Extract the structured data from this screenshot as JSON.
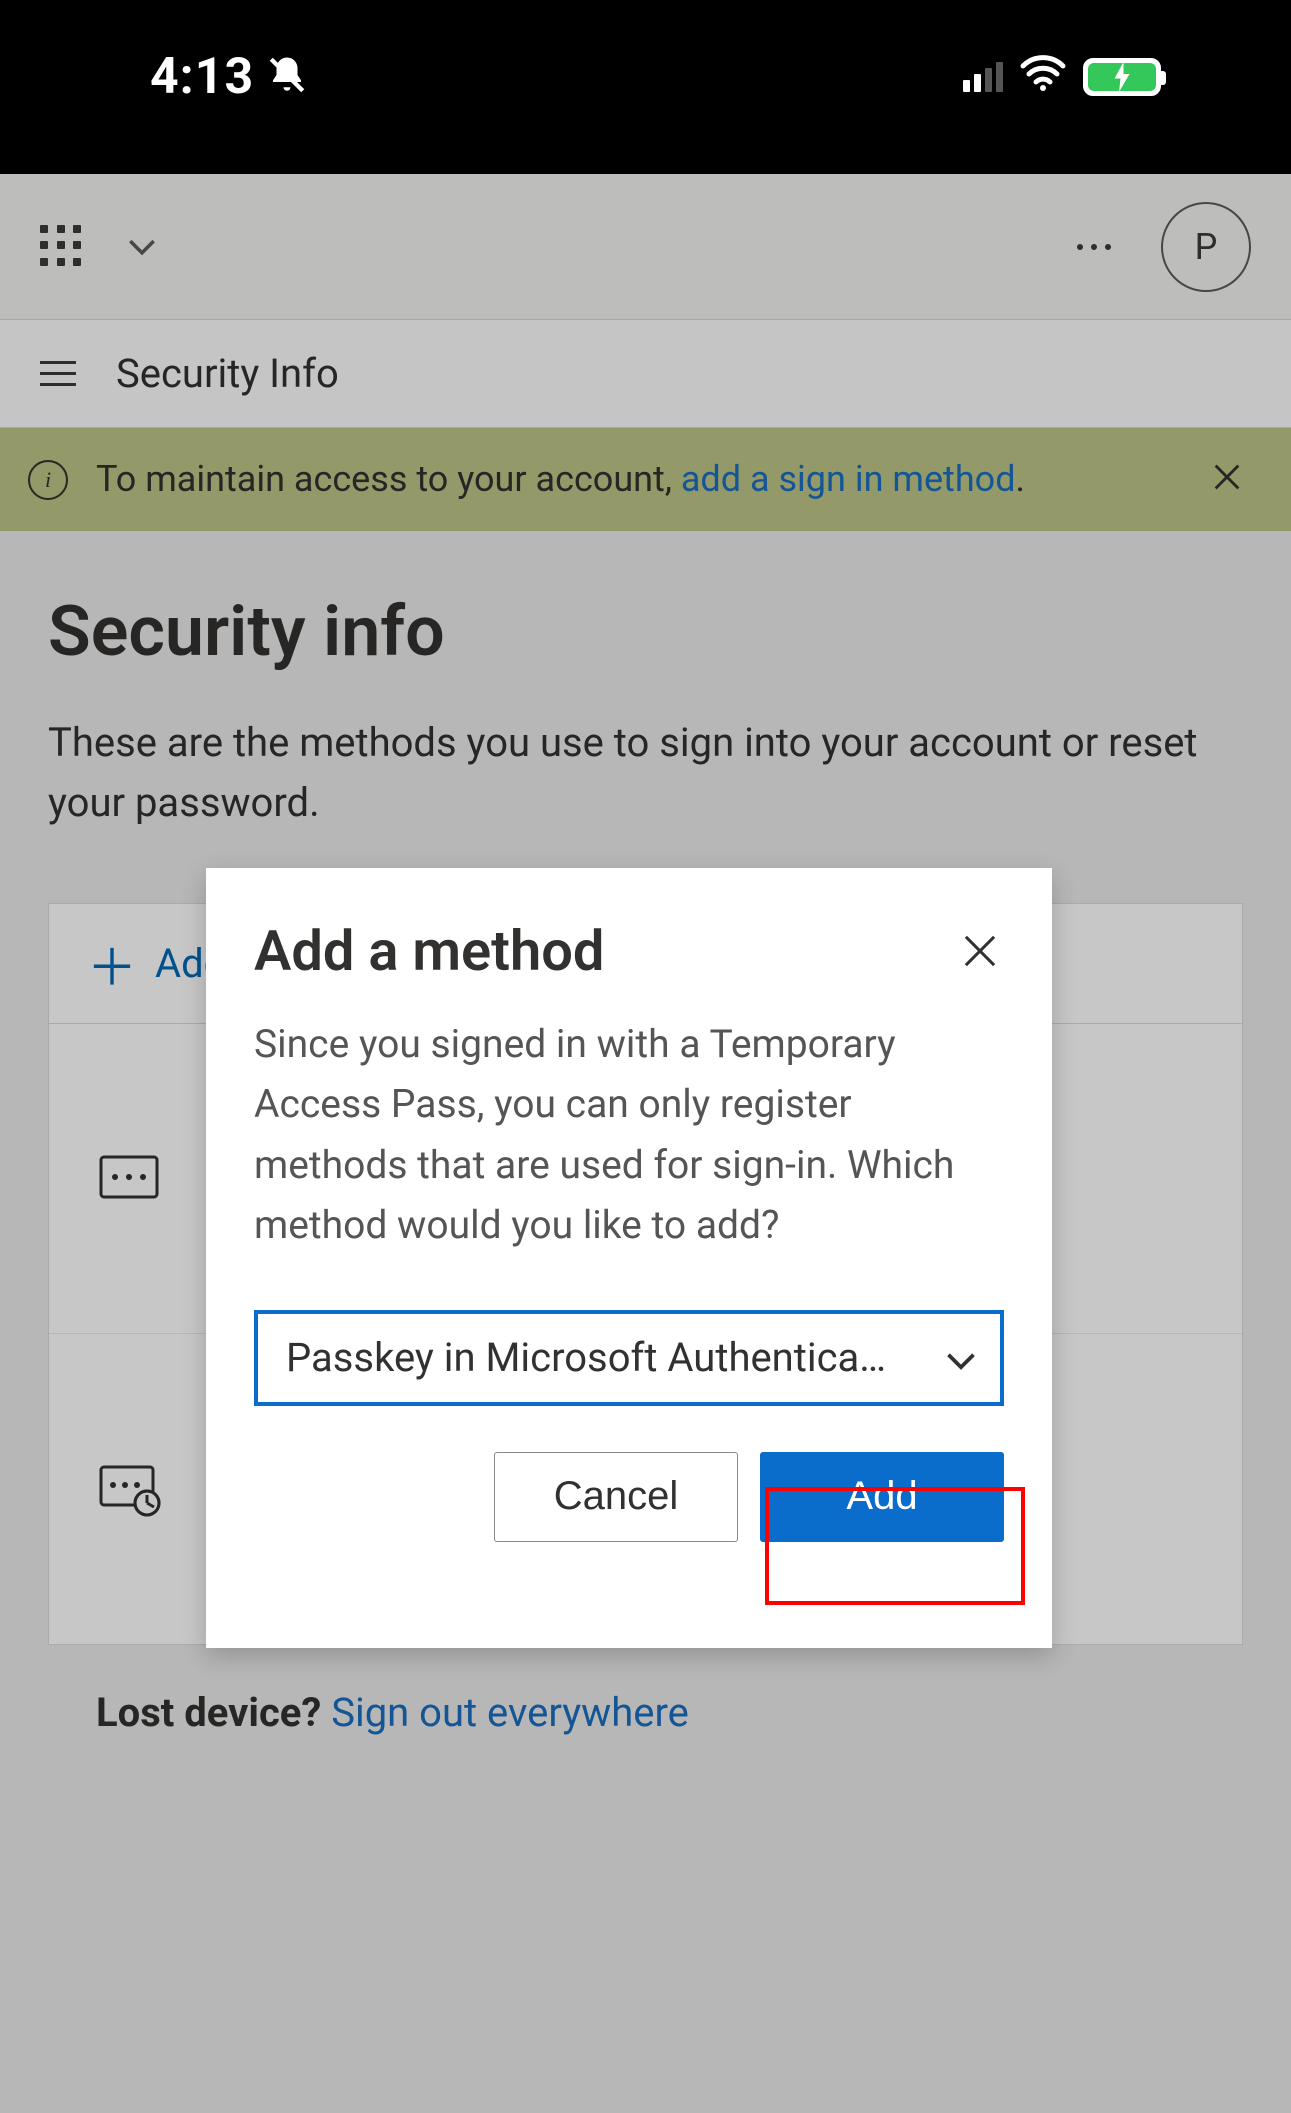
{
  "status_bar": {
    "time": "4:13"
  },
  "app_bar": {
    "avatar_initial": "P"
  },
  "secondary_header": {
    "title": "Security Info"
  },
  "banner": {
    "text_prefix": "To maintain access to your account, ",
    "link_text": "add a sign in method",
    "text_suffix": "."
  },
  "page": {
    "title": "Security info",
    "description": "These are the methods you use to sign into your account or reset your password."
  },
  "methods": {
    "add_label": "Add sign-in method"
  },
  "lost_device": {
    "label": "Lost device? ",
    "link": "Sign out everywhere"
  },
  "dialog": {
    "title": "Add a method",
    "body": "Since you signed in with a Temporary Access Pass, you can only register methods that are used for sign-in. Which method would you like to add?",
    "selected_option": "Passkey in Microsoft Authenticator",
    "cancel": "Cancel",
    "add": "Add"
  },
  "colors": {
    "accent": "#0b6dcb",
    "banner_bg": "#bdc487",
    "link": "#1a6fbf",
    "highlight": "#ff0000"
  }
}
